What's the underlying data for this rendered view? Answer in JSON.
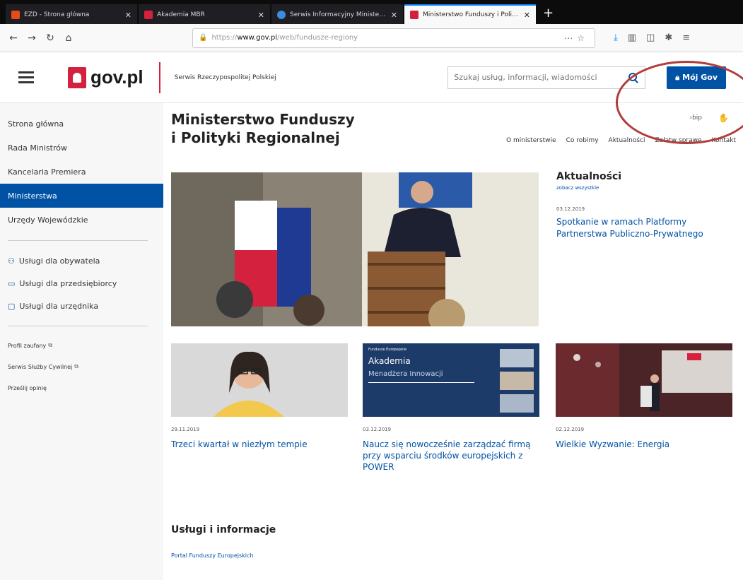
{
  "browser": {
    "tabs": [
      {
        "label": "EZD - Strona główna",
        "color": "#e64b1c"
      },
      {
        "label": "Akademia MBR",
        "color": "#d4213d"
      },
      {
        "label": "Serwis Informacyjny Ministerstwa",
        "color": "#3a8de0"
      },
      {
        "label": "Ministerstwo Funduszy i Polityki Regionalnej",
        "color": "#d4213d"
      }
    ],
    "url_prefix": "https://",
    "url_domain": "www.gov.pl",
    "url_path": "/web/fundusze-regiony"
  },
  "header": {
    "logo_text": "gov.pl",
    "service_name": "Serwis Rzeczypospolitej Polskiej",
    "search_placeholder": "Szukaj usług, informacji, wiadomości",
    "mojgov_label": "Mój Gov"
  },
  "sidebar": {
    "nav": [
      {
        "label": "Strona główna",
        "active": false
      },
      {
        "label": "Rada Ministrów",
        "active": false
      },
      {
        "label": "Kancelaria Premiera",
        "active": false
      },
      {
        "label": "Ministerstwa",
        "active": true
      },
      {
        "label": "Urzędy Wojewódzkie",
        "active": false
      }
    ],
    "services": [
      {
        "label": "Usługi dla obywatela",
        "icon": "person-icon"
      },
      {
        "label": "Usługi dla przedsiębiorcy",
        "icon": "briefcase-icon"
      },
      {
        "label": "Usługi dla urzędnika",
        "icon": "monitor-icon"
      }
    ],
    "links": [
      {
        "label": "Profil zaufany"
      },
      {
        "label": "Serwis Służby Cywilnej"
      },
      {
        "label": "Prześlij opinię"
      }
    ]
  },
  "ministry": {
    "title_line1": "Ministerstwo Funduszy",
    "title_line2": "i Polityki Regionalnej",
    "bip": "bip",
    "nav": [
      "O ministerstwie",
      "Co robimy",
      "Aktualności",
      "Załatw sprawę",
      "Kontakt"
    ]
  },
  "news": {
    "heading": "Aktualności",
    "see_all": "zobacz wszystkie",
    "featured_date": "03.12.2019",
    "featured_title": "Spotkanie w ramach Platformy Partnerstwa Publiczno-Prywatnego"
  },
  "cards": [
    {
      "date": "29.11.2019",
      "title": "Trzeci kwartał w niezłym tempie"
    },
    {
      "date": "03.12.2019",
      "title": "Naucz się nowocześnie zarządzać firmą przy wsparciu środków europejskich z POWER"
    },
    {
      "date": "02.12.2019",
      "title": "Wielkie Wyzwanie: Energia"
    }
  ],
  "banner": {
    "small": "Fundusze Europejskie",
    "line1": "Akademia",
    "line2": "Menadżera Innowacji"
  },
  "services_section": {
    "heading": "Usługi i informacje",
    "link": "Portal Funduszy Europejskich"
  },
  "colors": {
    "brand_blue": "#0052a5",
    "brand_red": "#d4213d",
    "annotation": "#b23c3c"
  }
}
